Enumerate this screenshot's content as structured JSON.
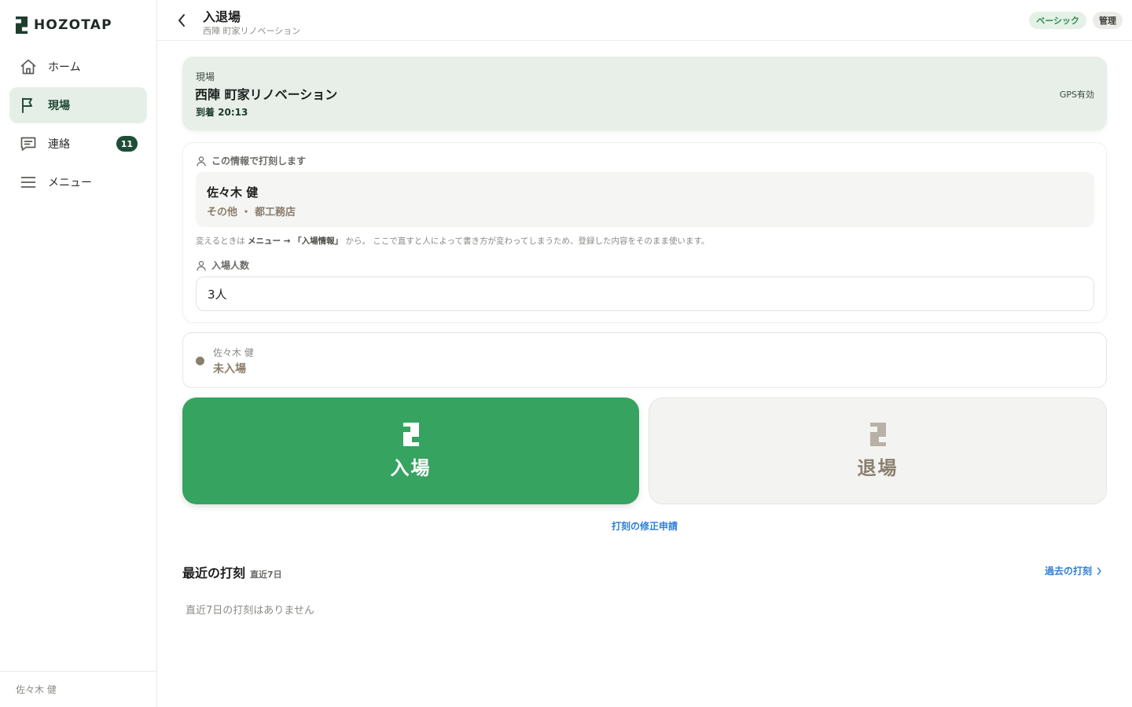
{
  "brand": {
    "name": "HOZOTAP"
  },
  "sidebar": {
    "items": [
      {
        "label": "ホーム",
        "icon": "home-icon",
        "active": false
      },
      {
        "label": "現場",
        "icon": "flag-icon",
        "active": true
      },
      {
        "label": "連絡",
        "icon": "chat-icon",
        "active": false,
        "badge": "11"
      },
      {
        "label": "メニュー",
        "icon": "menu-icon",
        "active": false
      }
    ],
    "footer_user": "佐々木 健"
  },
  "header": {
    "title": "入退場",
    "subtitle": "西陣 町家リノベーション",
    "plan_badge": "ベーシック",
    "role_badge": "管理"
  },
  "site": {
    "label": "現場",
    "name": "西陣 町家リノベーション",
    "arrival": "到着 20:13",
    "gps": "GPS有効"
  },
  "identity": {
    "section_label": "この情報で打刻します",
    "name": "佐々木 健",
    "org": "その他 ・ 都工務店",
    "note_prefix": "変えるときは ",
    "note_link": "メニュー → 「入場情報」",
    "note_suffix": " から。 ここで直すと人によって書き方が変わってしまうため、登録した内容をそのまま使います。"
  },
  "headcount": {
    "section_label": "入場人数",
    "value": "3人"
  },
  "status": {
    "name": "佐々木 健",
    "text": "未入場"
  },
  "actions": {
    "check_in": "入場",
    "check_out": "退場",
    "fix_request": "打刻の修正申請"
  },
  "recent": {
    "title": "最近の打刻",
    "subtitle": "直近7日",
    "past_link": "過去の打刻",
    "empty": "直近7日の打刻はありません"
  },
  "colors": {
    "accent_green": "#36a361",
    "nav_active_bg": "#e5efe7",
    "link_blue": "#2f7fd6",
    "badge_dark_green": "#1f4d3a"
  }
}
